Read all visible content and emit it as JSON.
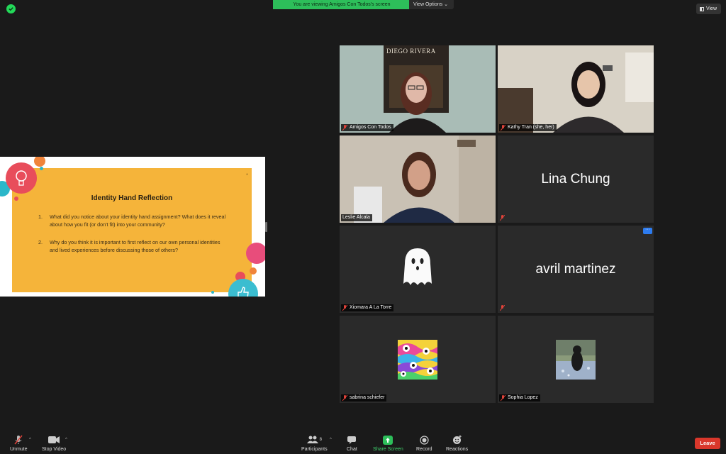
{
  "top_bar": {
    "banner_text": "You are viewing Amigos Con Todos's screen",
    "view_options_label": "View Options",
    "view_button_label": "View"
  },
  "slide": {
    "title": "Identity Hand Reflection",
    "items": [
      {
        "num": "1.",
        "text": "What did you notice about your identity hand assignment? What does it reveal about how you fit (or don't fit) into your community?"
      },
      {
        "num": "2.",
        "text": "Why do you think it is important to first reflect on our own personal identities and lived experiences before discussing those of others?"
      }
    ],
    "colors": {
      "panel": "#f5b43a",
      "background": "#ffffff"
    }
  },
  "participants": [
    {
      "name": "Amigos Con Todos",
      "muted": true,
      "video": true,
      "poster_text": "DIEGO RIVERA"
    },
    {
      "name": "Kathy Tran (she, her)",
      "muted": true,
      "video": true
    },
    {
      "name": "Leslie Alcala",
      "muted": false,
      "video": true,
      "active_speaker": true
    },
    {
      "name": "Lina Chung",
      "muted": true,
      "video": false
    },
    {
      "name": "Xiomara A La Torre",
      "muted": true,
      "video": false,
      "avatar": "ghost"
    },
    {
      "name": "avril martinez",
      "muted": true,
      "video": false
    },
    {
      "name": "sabrina schiefer",
      "muted": true,
      "video": false,
      "avatar": "psychedelic-flowers"
    },
    {
      "name": "Sophia Lopez",
      "muted": true,
      "video": false,
      "avatar": "cat-photo"
    }
  ],
  "toolbar": {
    "unmute": "Unmute",
    "stop_video": "Stop Video",
    "participants": "Participants",
    "participants_count": "8",
    "chat": "Chat",
    "share_screen": "Share Screen",
    "record": "Record",
    "reactions": "Reactions",
    "leave": "Leave"
  },
  "colors": {
    "accent_green": "#2dbe5a",
    "leave_red": "#d9372b",
    "active_speaker": "#e2e86f",
    "muted_icon": "#e0433a"
  }
}
